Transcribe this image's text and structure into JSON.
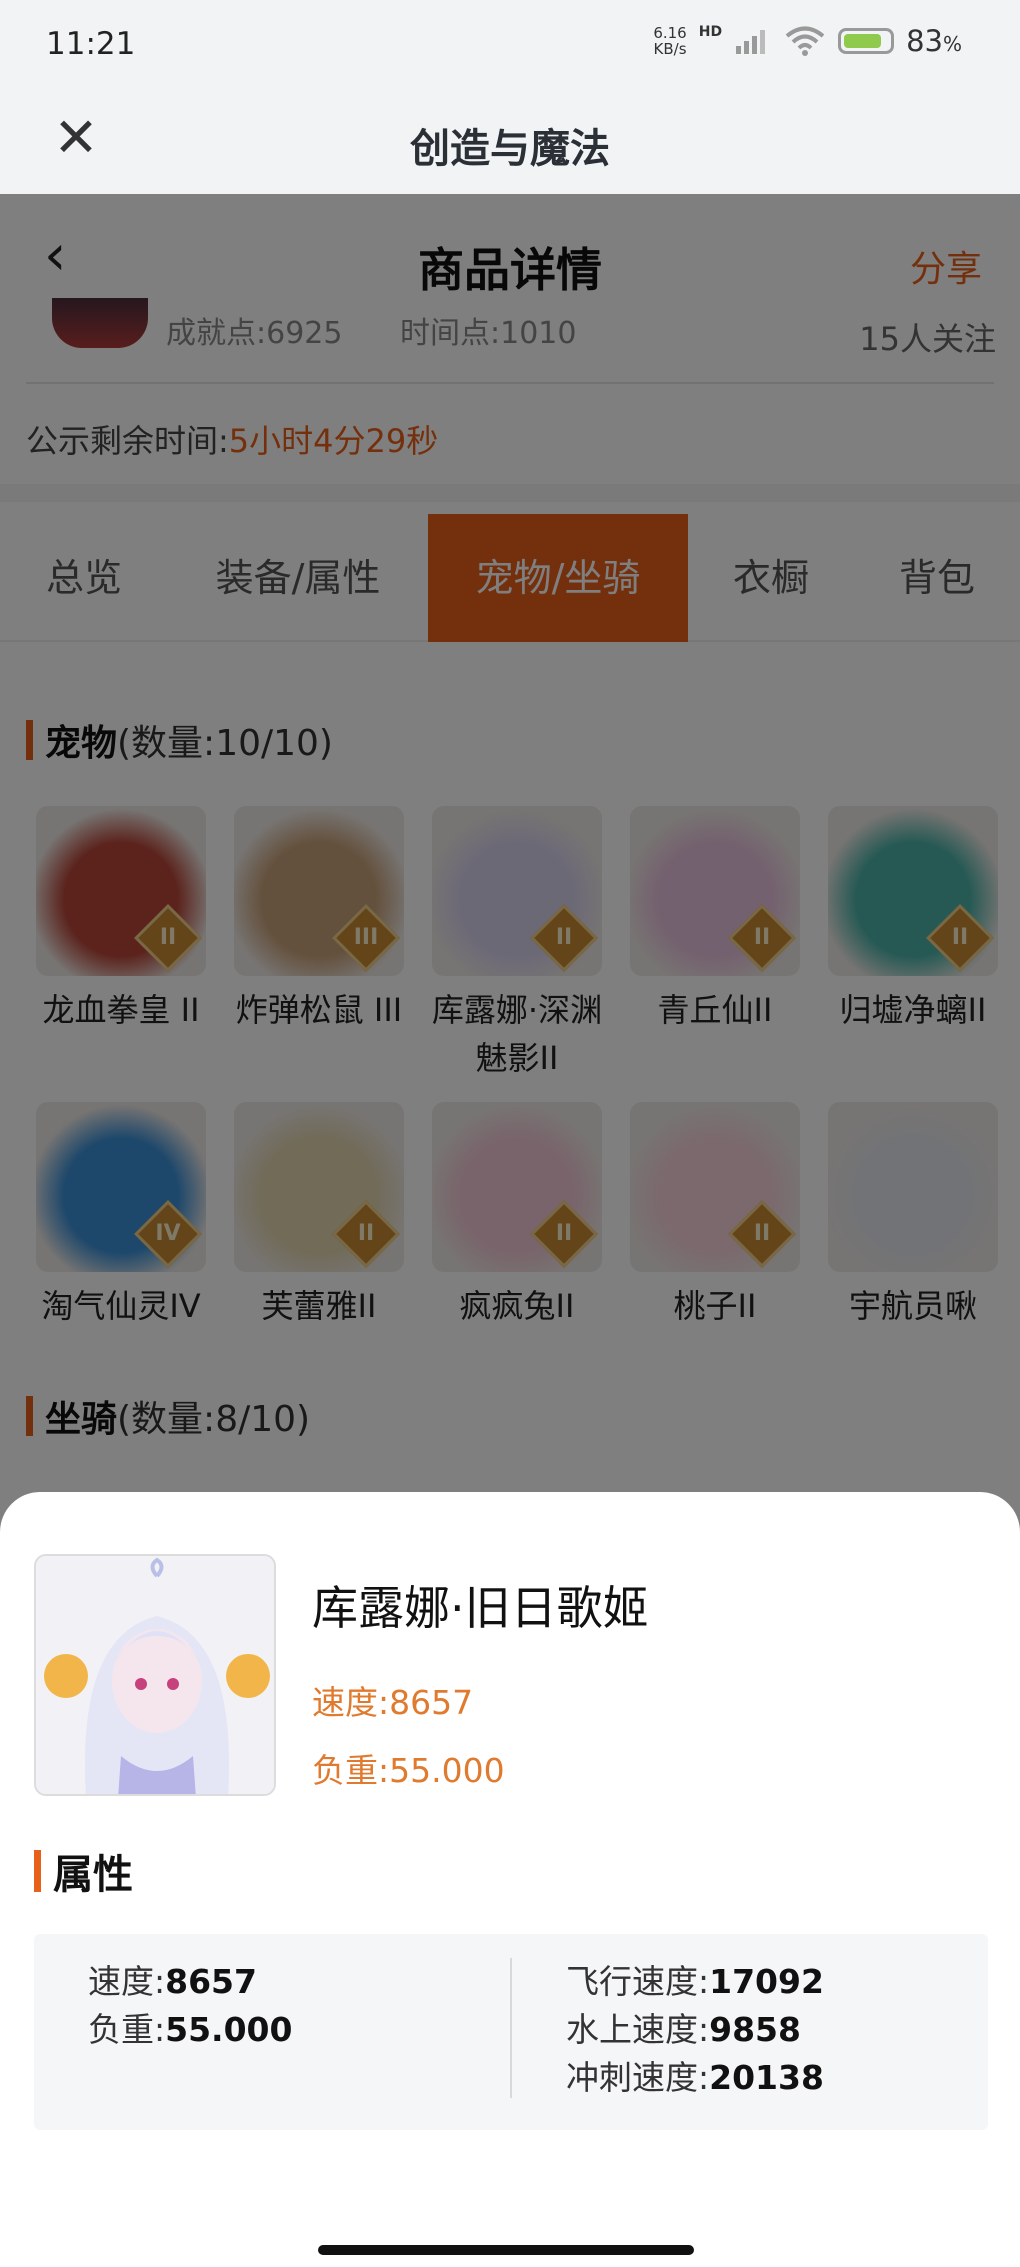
{
  "status_bar": {
    "time": "11:21",
    "net_speed_value": "6.16",
    "net_speed_unit": "KB/s",
    "hd_label": "HD",
    "battery_percent": "83",
    "battery_unit": "%",
    "battery_level": 0.83
  },
  "app_bar": {
    "title": "创造与魔法",
    "close_icon": "close-icon"
  },
  "nav": {
    "back_icon": "chevron-left-icon",
    "title": "商品详情",
    "share_label": "分享"
  },
  "seller": {
    "achievement": "成就点:6925",
    "time_points": "时间点:1010",
    "followers": "15人关注"
  },
  "notice": {
    "label": "公示剩余时间:",
    "remaining": "5小时4分29秒"
  },
  "tabs": [
    {
      "label": "总览",
      "active": false
    },
    {
      "label": "装备/属性",
      "active": false
    },
    {
      "label": "宠物/坐骑",
      "active": true
    },
    {
      "label": "衣橱",
      "active": false
    },
    {
      "label": "背包",
      "active": false
    }
  ],
  "pets_section": {
    "title": "宠物",
    "count": "(数量:10/10)",
    "items": [
      {
        "name": "龙血拳皇 II",
        "badge": "II",
        "color": "#b8473a"
      },
      {
        "name": "炸弹松鼠 III",
        "badge": "III",
        "color": "#c9a27a"
      },
      {
        "name": "库露娜·深渊魅影II",
        "badge": "II",
        "color": "#d9d3ef"
      },
      {
        "name": "青丘仙II",
        "badge": "II",
        "color": "#e9c3de"
      },
      {
        "name": "归墟净螭II",
        "badge": "II",
        "color": "#4cb3a8"
      },
      {
        "name": "淘气仙灵IV",
        "badge": "IV",
        "color": "#3a8fd6"
      },
      {
        "name": "芙蕾雅II",
        "badge": "II",
        "color": "#e2d6b0"
      },
      {
        "name": "疯疯兔II",
        "badge": "II",
        "color": "#f2c9d6"
      },
      {
        "name": "桃子II",
        "badge": "II",
        "color": "#f6d3dc"
      },
      {
        "name": "宇航员啾",
        "badge": "",
        "color": "#e5e7ee"
      }
    ]
  },
  "mounts_section": {
    "title": "坐骑",
    "count": "(数量:8/10)"
  },
  "sheet": {
    "name": "库露娜·旧日歌姬",
    "speed": "速度:8657",
    "load": "负重:55.000",
    "section_title": "属性",
    "attrs_left": [
      {
        "label": "速度:",
        "value": "8657"
      },
      {
        "label": "负重:",
        "value": "55.000"
      }
    ],
    "attrs_right": [
      {
        "label": "飞行速度:",
        "value": "17092"
      },
      {
        "label": "水上速度:",
        "value": "9858"
      },
      {
        "label": "冲刺速度:",
        "value": "20138"
      }
    ]
  }
}
